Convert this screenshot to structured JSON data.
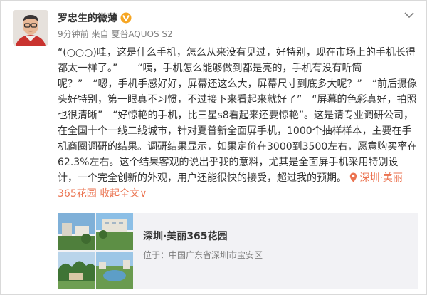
{
  "author": {
    "name": "罗忠生的微薄",
    "verified_icon": "verified-v-badge"
  },
  "meta": {
    "time": "9分钟前",
    "from_label": "来自",
    "source": "夏普AQUOS S2"
  },
  "content_lines": [
    "“(○○○)哇，这是什么手机，怎么从来没有见过，好特别，现在市场上的手机长得",
    "都太一样了。”　　“咦，手机怎么能够做到都是亮的，手机有没有听筒",
    "呢？”　“嗯，手机手感好好，屏幕还这么大，屏幕尺寸到底多大呢？”　“前后摄像",
    "头好特别，第一眼真不习惯，不过接下来看起来就好了”　“屏幕的色彩真好，拍照",
    "也很清晰”　“好惊艳的手机，比三星s8看起来还要惊艳”。这是请专业调研公司，",
    "在全国十个一线二线城市，针对夏普新全面屏手机，1000个抽样样本，主要在手",
    "机商圈调研的结果。调研结果显示，如果定价在3000到3500左右，愿意购买率在",
    "62.3%左右。这个结果客观的说出乎我的意料，尤其是全面屏手机采用特别设",
    "计，一个完全创新的外观，用户还能很快的接受，超过我的预期。 "
  ],
  "location_part1": "深圳·美丽",
  "location_part2": "365花园",
  "collapse_label": "收起全文",
  "collapse_arrow": "∨",
  "location_card": {
    "title": "深圳·美丽365花园",
    "address_label": "位于：",
    "address": "中国广东省深圳市宝安区"
  },
  "colors": {
    "accent": "#eb7350",
    "verified": "#f6a623",
    "card_bg": "#f2f2f5"
  }
}
